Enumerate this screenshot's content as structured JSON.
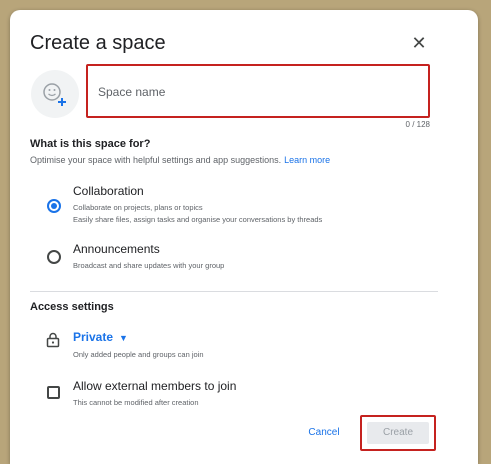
{
  "dialog": {
    "title": "Create a space",
    "close_icon": "close-icon"
  },
  "name_field": {
    "placeholder": "Space name",
    "value": "",
    "counter": "0 / 128"
  },
  "purpose": {
    "title": "What is this space for?",
    "hint": "Optimise your space with helpful settings and app suggestions.",
    "learn_more": "Learn more",
    "options": [
      {
        "label": "Collaboration",
        "desc1": "Collaborate on projects, plans or topics",
        "desc2": "Easily share files, assign tasks and organise your conversations by threads",
        "selected": true
      },
      {
        "label": "Announcements",
        "desc1": "Broadcast and share updates with your group",
        "selected": false
      }
    ]
  },
  "access": {
    "title": "Access settings",
    "value": "Private",
    "desc": "Only added people and groups can join",
    "external_label": "Allow external members to join",
    "external_desc": "This cannot be modified after creation",
    "external_checked": false
  },
  "actions": {
    "cancel": "Cancel",
    "create": "Create"
  },
  "colors": {
    "accent": "#1a73e8",
    "highlight": "#c5221f",
    "backdrop": "#b8a57a"
  }
}
